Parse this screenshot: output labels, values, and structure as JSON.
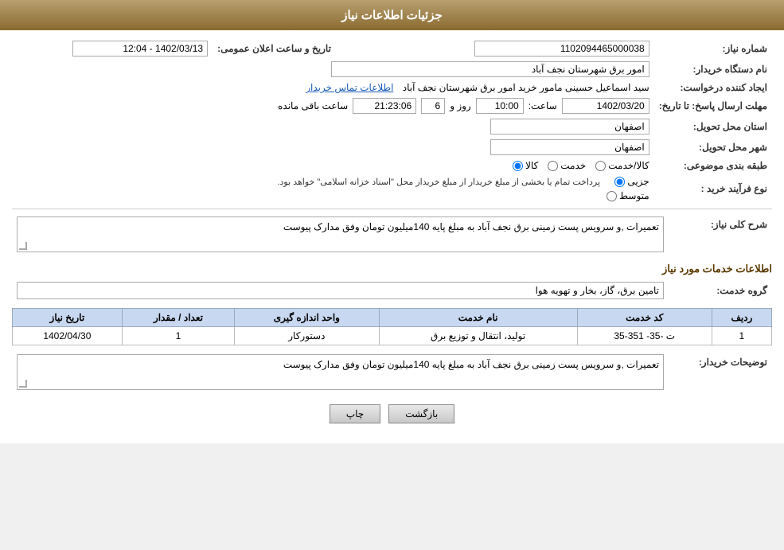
{
  "header": {
    "title": "جزئیات اطلاعات نیاز"
  },
  "fields": {
    "need_number_label": "شماره نیاز:",
    "need_number_value": "1102094465000038",
    "date_label": "تاریخ و ساعت اعلان عمومی:",
    "date_value": "1402/03/13 - 12:04",
    "buyer_org_label": "نام دستگاه خریدار:",
    "buyer_org_value": "امور برق شهرستان نجف آباد",
    "creator_label": "ایجاد کننده درخواست:",
    "creator_value": "سید اسماعیل  حسینی  مامور خرید  امور برق شهرستان نجف آباد",
    "creator_link": "اطلاعات تماس خریدار",
    "deadline_label": "مهلت ارسال پاسخ: تا تاریخ:",
    "deadline_date": "1402/03/20",
    "deadline_time_label": "ساعت:",
    "deadline_time": "10:00",
    "deadline_day_label": "روز و",
    "deadline_day": "6",
    "deadline_remaining_label": "ساعت باقی مانده",
    "deadline_remaining": "21:23:06",
    "province_label": "استان محل تحویل:",
    "province_value": "اصفهان",
    "city_label": "شهر محل تحویل:",
    "city_value": "اصفهان",
    "category_label": "طبقه بندی موضوعی:",
    "category_options": [
      "کالا",
      "خدمت",
      "کالا/خدمت"
    ],
    "category_selected": "کالا",
    "purchase_type_label": "نوع فرآیند خرید :",
    "purchase_type_options": [
      "جزیی",
      "متوسط"
    ],
    "purchase_type_selected": "جزیی",
    "purchase_type_note": "پرداخت تمام یا بخشی از مبلغ خریدار از مبلغ خریداز محل \"اسناد خزانه اسلامی\" خواهد بود.",
    "description_label": "شرح کلی نیاز:",
    "description_value": "تعمیرات ,و سرویس پست زمینی   برق نجف آباد  به مبلغ پایه 140میلیون تومان وفق مدارک پیوست",
    "services_label": "اطلاعات خدمات مورد نیاز",
    "service_group_label": "گروه خدمت:",
    "service_group_value": "تامین برق، گاز، بخار و تهویه هوا",
    "table": {
      "headers": [
        "ردیف",
        "کد خدمت",
        "نام خدمت",
        "واحد اندازه گیری",
        "تعداد / مقدار",
        "تاریخ نیاز"
      ],
      "rows": [
        {
          "row": "1",
          "code": "ت -35- 351-35",
          "name": "تولید، انتقال و توزیع برق",
          "unit": "دستورکار",
          "count": "1",
          "date": "1402/04/30"
        }
      ]
    },
    "buyer_notes_label": "توضیحات خریدار:",
    "buyer_notes_value": "تعمیرات ,و سرویس پست زمینی   برق نجف آباد  به مبلغ پایه 140میلیون تومان وفق مدارک پیوست"
  },
  "buttons": {
    "print": "چاپ",
    "back": "بازگشت"
  }
}
